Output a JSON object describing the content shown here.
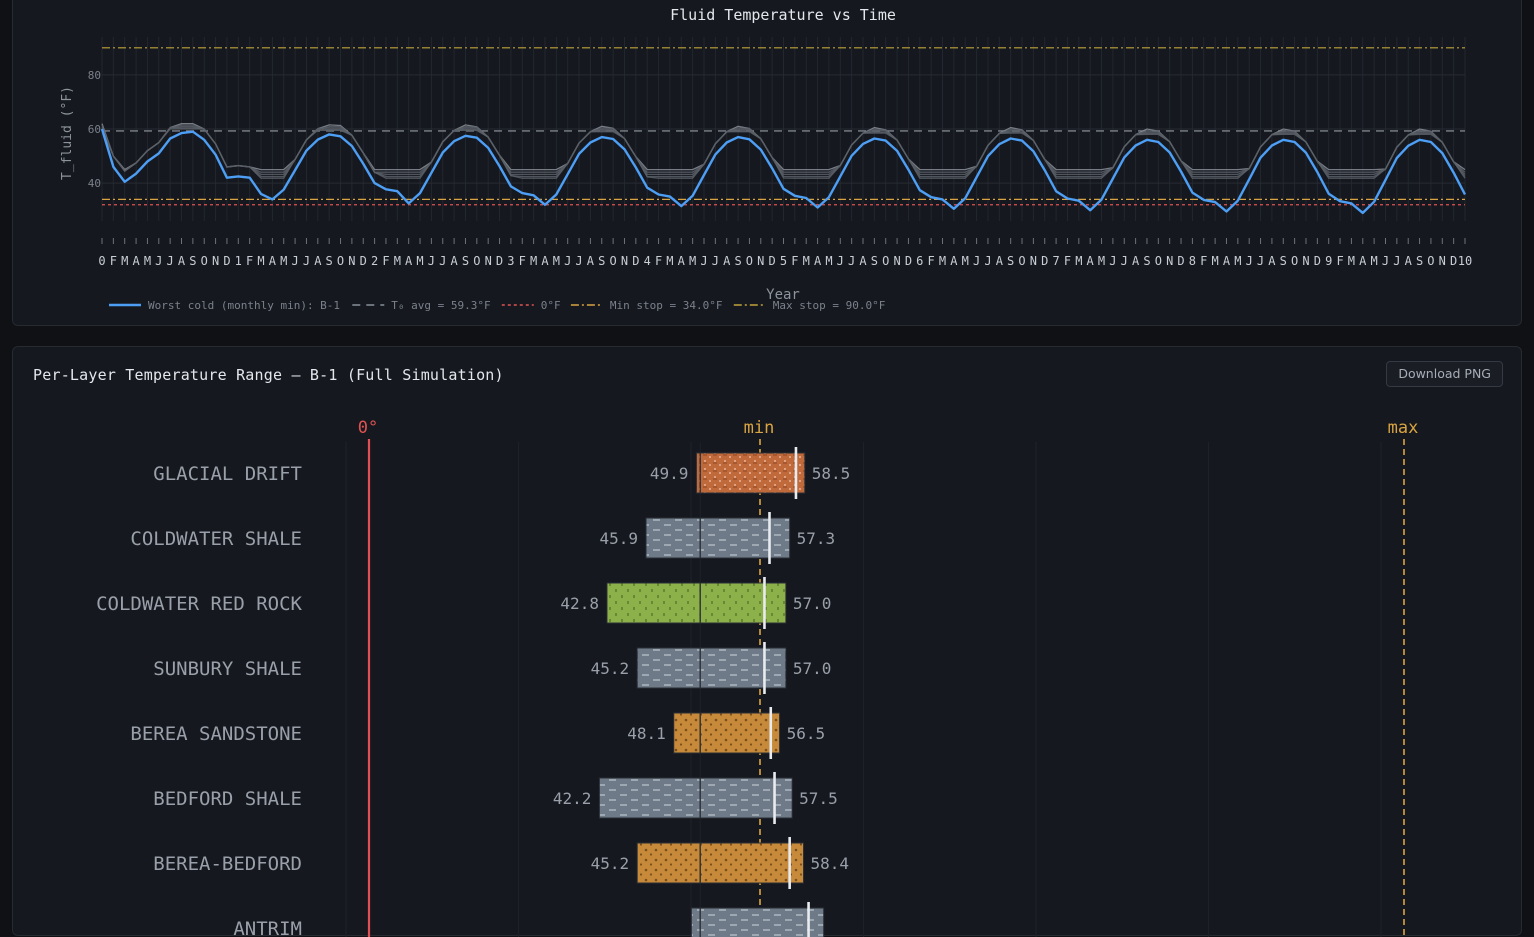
{
  "top_chart": {
    "title": "Fluid Temperature vs Time",
    "xlabel": "Year",
    "ylabel": "T_fluid (°F)",
    "legend": [
      {
        "label": "Worst cold (monthly min): B-1",
        "color": "#4d9ef5",
        "style": "solid"
      },
      {
        "label": "T₀ avg = 59.3°F",
        "color": "#8a8f98",
        "style": "dashed"
      },
      {
        "label": "0°F",
        "color": "#e05252",
        "style": "dotted"
      },
      {
        "label": "Min stop = 34.0°F",
        "color": "#d9a441",
        "style": "dashdot"
      },
      {
        "label": "Max stop = 90.0°F",
        "color": "#c2a23a",
        "style": "dashdot"
      }
    ]
  },
  "bottom_chart": {
    "title": "Per-Layer Temperature Range — B-1 (Full Simulation)",
    "download_label": "Download PNG",
    "marker_labels": {
      "zero": "0°",
      "min": "min",
      "max": "max"
    }
  },
  "chart_data": [
    {
      "type": "line",
      "title": "Fluid Temperature vs Time",
      "xlabel": "Year",
      "ylabel": "T_fluid (°F)",
      "ylim": [
        26,
        94
      ],
      "yticks": [
        40,
        60,
        80
      ],
      "grid": true,
      "legend_position": "bottom-left",
      "x_year_labels": [
        "0",
        "1",
        "2",
        "3",
        "4",
        "5",
        "6",
        "7",
        "8",
        "9",
        "10"
      ],
      "x_month_letters": [
        "F",
        "M",
        "A",
        "M",
        "J",
        "J",
        "A",
        "S",
        "O",
        "N",
        "D"
      ],
      "reference_lines": [
        {
          "name": "T₀ avg",
          "value": 59.3
        },
        {
          "name": "0°F",
          "value": 32
        },
        {
          "name": "Min stop",
          "value": 34.0
        },
        {
          "name": "Max stop",
          "value": 90.0
        }
      ],
      "worst_cold_by_month": [
        60,
        46,
        40.5,
        43.5,
        48,
        51,
        56.5,
        58.5,
        59,
        56,
        50.5,
        42,
        42.5,
        42,
        36
      ],
      "year_minima": [
        36,
        34,
        32.5,
        32,
        31.5,
        31,
        30.5,
        30,
        29.5,
        29
      ],
      "year_maxima": [
        59,
        58,
        57.5,
        57,
        57,
        56.5,
        56.5,
        56,
        56,
        56
      ],
      "year_layer_upper": [
        61,
        60.5,
        60.5,
        60,
        60,
        59.5,
        59.5,
        59,
        59,
        59
      ]
    },
    {
      "type": "bar",
      "title": "Per-Layer Temperature Range — B-1 (Full Simulation)",
      "orientation": "horizontal",
      "reference_markers": {
        "zero": 0,
        "min": 34.0,
        "max": 90.0
      },
      "categories": [
        "GLACIAL DRIFT",
        "COLDWATER SHALE",
        "COLDWATER RED ROCK",
        "SUNBURY SHALE",
        "BEREA SANDSTONE",
        "BEDFORD SHALE",
        "BEREA-BEDFORD",
        "ANTRIM"
      ],
      "min_values": [
        49.9,
        45.9,
        42.8,
        45.2,
        48.1,
        42.2,
        45.2,
        49.5
      ],
      "max_values": [
        58.5,
        57.3,
        57.0,
        57.0,
        56.5,
        57.5,
        58.4,
        60.0
      ],
      "min_labels": [
        "49.9",
        "45.9",
        "42.8",
        "45.2",
        "48.1",
        "42.2",
        "45.2",
        ""
      ],
      "max_labels": [
        "58.5",
        "57.3",
        "57.0",
        "57.0",
        "56.5",
        "57.5",
        "58.4",
        ""
      ],
      "average_markers": [
        57.8,
        55.7,
        55.3,
        55.3,
        55.8,
        56.1,
        57.3,
        58.8
      ],
      "layer_colors": [
        "#c06a3b",
        "#6e7a87",
        "#8cb04a",
        "#6e7a87",
        "#c68a3a",
        "#6e7a87",
        "#c68a3a",
        "#6e7a87"
      ],
      "layer_patterns": [
        "dots",
        "dash",
        "grass",
        "dash",
        "dots",
        "dash",
        "dots",
        "dash"
      ]
    }
  ]
}
